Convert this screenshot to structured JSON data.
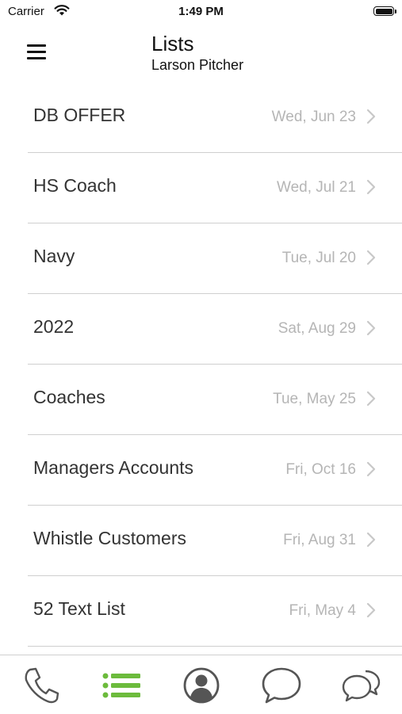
{
  "status_bar": {
    "carrier": "Carrier",
    "time": "1:49 PM"
  },
  "header": {
    "title": "Lists",
    "subtitle": "Larson Pitcher"
  },
  "lists": [
    {
      "name": "DB OFFER",
      "date": "Wed, Jun 23"
    },
    {
      "name": "HS Coach",
      "date": "Wed, Jul 21"
    },
    {
      "name": "Navy",
      "date": "Tue, Jul 20"
    },
    {
      "name": "2022",
      "date": "Sat, Aug 29"
    },
    {
      "name": "Coaches",
      "date": "Tue, May 25"
    },
    {
      "name": "Managers Accounts",
      "date": "Fri, Oct 16"
    },
    {
      "name": "Whistle Customers",
      "date": "Fri, Aug 31"
    },
    {
      "name": "52 Text List",
      "date": "Fri, May 4"
    }
  ],
  "tabbar": {
    "tabs": [
      "phone-icon",
      "lists-icon",
      "contact-icon",
      "chat-icon",
      "group-chat-icon"
    ],
    "active": "lists-icon"
  },
  "colors": {
    "accent": "#6cbb3c",
    "date": "#b5b5b5",
    "divider": "#cfcfcf"
  }
}
